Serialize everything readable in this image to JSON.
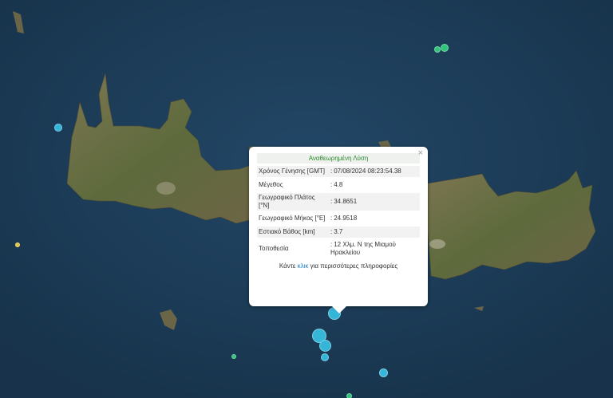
{
  "popup": {
    "title": "Αναθεωρημένη Λύση",
    "close_glyph": "×",
    "rows": [
      {
        "label": "Χρόνος Γένησης [GMT]",
        "value": "07/08/2024 08:23:54.38"
      },
      {
        "label": "Μέγεθος",
        "value": "4.8"
      },
      {
        "label": "Γεωγραφικό Πλάτος [°N]",
        "value": "34.8651"
      },
      {
        "label": "Γεωγραφικό Μήκος [°E]",
        "value": "24.9518"
      },
      {
        "label": "Εστιακό Βάθος [km]",
        "value": "3.7"
      },
      {
        "label": "Τοποθεσία",
        "value": "12 Χλμ. Ν της Μιαμού Ηρακλείου"
      }
    ],
    "more_prefix": "Κάντε ",
    "more_link": "κλικ",
    "more_suffix": " για περισσότερες πληροφορίες"
  },
  "colors": {
    "sea": "#1d3a54",
    "land": "#6e6a45",
    "marker_cyan": "#35b5d8",
    "marker_green": "#2ec47a",
    "marker_yellow": "#e4c43c",
    "title_green": "#2b8a2b",
    "link_blue": "#1a7fc8"
  },
  "markers": [
    {
      "name": "earthquake-marker-main",
      "color": "cyan"
    },
    {
      "name": "earthquake-marker",
      "color": "cyan"
    },
    {
      "name": "earthquake-marker",
      "color": "cyan"
    },
    {
      "name": "earthquake-marker",
      "color": "cyan"
    },
    {
      "name": "earthquake-marker",
      "color": "cyan"
    },
    {
      "name": "earthquake-marker",
      "color": "cyan"
    },
    {
      "name": "earthquake-marker",
      "color": "green"
    },
    {
      "name": "earthquake-marker",
      "color": "green"
    },
    {
      "name": "earthquake-marker",
      "color": "green"
    },
    {
      "name": "earthquake-marker",
      "color": "green"
    },
    {
      "name": "earthquake-marker",
      "color": "yellow"
    }
  ]
}
